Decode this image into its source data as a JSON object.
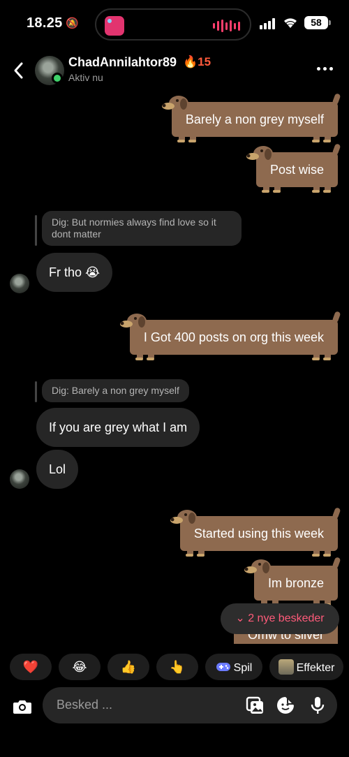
{
  "status_bar": {
    "time": "18.25",
    "battery": "58"
  },
  "header": {
    "name": "ChadAnnilahtor89",
    "streak": "🔥15",
    "status": "Aktiv nu"
  },
  "messages": [
    {
      "type": "sent",
      "text": "Barely a non grey myself"
    },
    {
      "type": "sent",
      "text": "Post wise"
    },
    {
      "type": "reply_quote",
      "text": "Dig: But normies always find love so it dont matter"
    },
    {
      "type": "received",
      "text": "Fr tho 😭"
    },
    {
      "type": "sent",
      "text": "I Got 400 posts on org this week"
    },
    {
      "type": "reply_quote",
      "text": "Dig: Barely a non grey myself"
    },
    {
      "type": "received",
      "text": "If you are grey what I am"
    },
    {
      "type": "received",
      "text": "Lol"
    },
    {
      "type": "sent",
      "text": "Started using this week"
    },
    {
      "type": "sent",
      "text": "Im bronze"
    },
    {
      "type": "sent",
      "text": "Omw to silver"
    }
  ],
  "new_messages": "⌄ 2 nye beskeder",
  "reactions": [
    {
      "emoji": "❤️"
    },
    {
      "emoji": "😂"
    },
    {
      "emoji": "👍"
    },
    {
      "emoji": "👆"
    },
    {
      "label": "Spil",
      "icon": "gamepad-icon"
    },
    {
      "label": "Effekter",
      "icon": "effects-icon"
    }
  ],
  "composer": {
    "placeholder": "Besked ..."
  },
  "colors": {
    "sent_bubble": "#8e6a4f",
    "received_bubble": "#262626",
    "online": "#3fd26a",
    "accent": "#ff5b7a"
  }
}
